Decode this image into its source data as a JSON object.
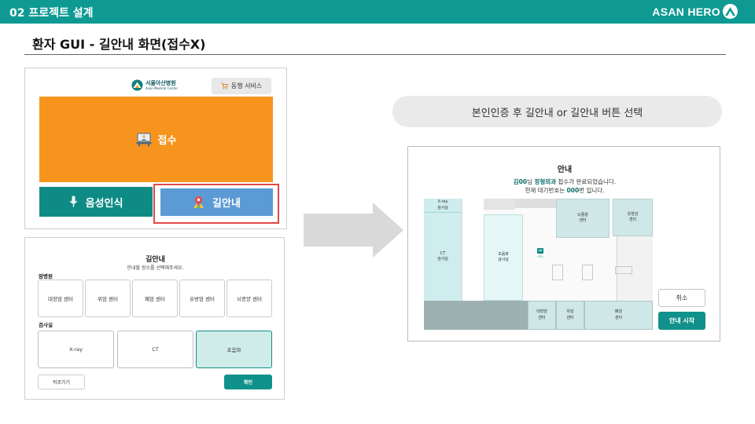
{
  "header": {
    "section": "02 프로젝트 설계",
    "brand": "ASAN HERO"
  },
  "page_title": "환자 GUI - 길안내 화면(접수X)",
  "kiosk_main": {
    "hospital_name": "서울아산병원",
    "hospital_sub": "Asan Medical Center",
    "escort_label": "동행 서비스",
    "reception_label": "접수",
    "voice_label": "음성인식",
    "guide_label": "길안내"
  },
  "directory": {
    "title": "길안내",
    "subtitle": "안내할 장소를 선택해주세요.",
    "cancer_label": "암병원",
    "cancer_centers": [
      "대장암 센터",
      "위암 센터",
      "폐암 센터",
      "유방암 센터",
      "뇌종양 센터"
    ],
    "exam_label": "검사실",
    "exams": [
      "X-ray",
      "CT",
      "초음파"
    ],
    "selected_exam": "초음파",
    "back_label": "뒤로가기",
    "confirm_label": "확인"
  },
  "instruction": "본인인증 후 길안내 or 길안내 버튼 선택",
  "guide_panel": {
    "title": "안내",
    "patient_name": "김00",
    "line1_suffix": "님",
    "department": "정형외과",
    "line1_end": "접수가 완료되었습니다.",
    "line2_start": "현재 대기번호는",
    "queue_number": "000",
    "line2_end": "번 입니다.",
    "rooms": {
      "xray": [
        "X-ray",
        "검사실"
      ],
      "ct": [
        "CT",
        "검사실"
      ],
      "ultrasound": [
        "초음파",
        "검사실"
      ],
      "brain": [
        "뇌종양",
        "센터"
      ],
      "breast": [
        "유방암",
        "센터"
      ],
      "colon": [
        "대장암",
        "센터"
      ],
      "stomach": [
        "위암",
        "센터"
      ],
      "lung": [
        "폐암",
        "센터"
      ]
    },
    "cancel_label": "취소",
    "start_label": "안내 시작"
  },
  "colors": {
    "teal": "#0e9a93",
    "orange": "#f7941d",
    "blue": "#5b9ad4",
    "highlight": "#e04848"
  }
}
